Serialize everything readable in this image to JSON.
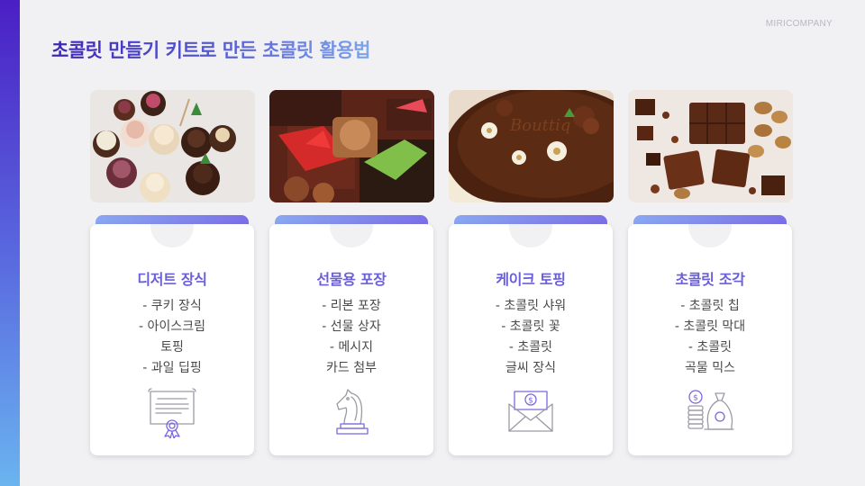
{
  "brand": "MIRICOMPANY",
  "title": "초콜릿 만들기 키트로 만든 초콜릿 활용법",
  "photos": [
    {
      "icon": "chocolate-dessert-photo"
    },
    {
      "icon": "gift-box-photo"
    },
    {
      "icon": "chocolate-cake-photo"
    },
    {
      "icon": "chocolate-pieces-photo"
    }
  ],
  "cards": [
    {
      "title": "디저트 장식",
      "lines": [
        "- 쿠키 장식",
        "- 아이스크림",
        "토핑",
        "- 과일 딥핑"
      ],
      "icon": "certificate-icon"
    },
    {
      "title": "선물용 포장",
      "lines": [
        "- 리본 포장",
        "- 선물 상자",
        "- 메시지",
        "카드 첨부"
      ],
      "icon": "chess-knight-icon"
    },
    {
      "title": "케이크 토핑",
      "lines": [
        "- 초콜릿 샤워",
        "- 초콜릿 꽃",
        "- 초콜릿",
        "글씨 장식"
      ],
      "icon": "money-envelope-icon"
    },
    {
      "title": "초콜릿 조각",
      "lines": [
        "- 초콜릿 칩",
        "- 초콜릿 막대",
        "- 초콜릿",
        "곡물 믹스"
      ],
      "icon": "money-bag-coins-icon"
    }
  ],
  "colors": {
    "accent": "#6a5fd6",
    "title_start": "#3b25b8",
    "title_end": "#7ea6ec",
    "side_bar": "#4a1fc4"
  }
}
